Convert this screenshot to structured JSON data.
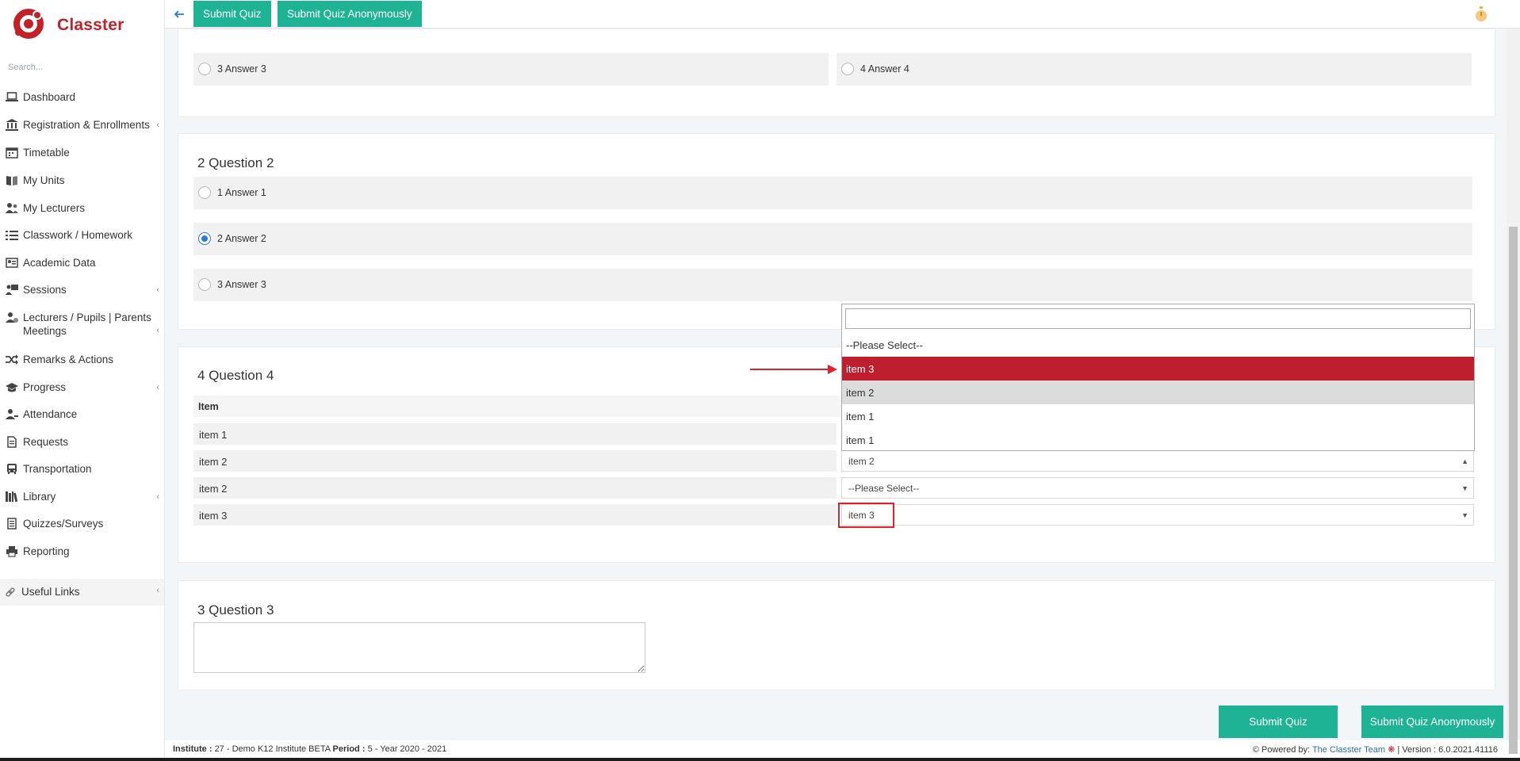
{
  "app": {
    "name": "Classter",
    "brand_color": "#c22129",
    "accent": "#1db394"
  },
  "sidebar": {
    "search_placeholder": "Search...",
    "items": [
      {
        "label": "Dashboard",
        "icon": "laptop-icon",
        "has_submenu": false
      },
      {
        "label": "Registration & Enrollments",
        "icon": "institution-icon",
        "has_submenu": true
      },
      {
        "label": "Timetable",
        "icon": "calendar-icon",
        "has_submenu": false
      },
      {
        "label": "My Units",
        "icon": "book-icon",
        "has_submenu": false
      },
      {
        "label": "My Lecturers",
        "icon": "users-icon",
        "has_submenu": false
      },
      {
        "label": "Classwork / Homework",
        "icon": "tasks-icon",
        "has_submenu": false
      },
      {
        "label": "Academic Data",
        "icon": "id-card-icon",
        "has_submenu": false
      },
      {
        "label": "Sessions",
        "icon": "presentation-icon",
        "has_submenu": true
      },
      {
        "label": "Lecturers / Pupils | Parents Meetings",
        "icon": "user-meeting-icon",
        "has_submenu": true
      },
      {
        "label": "Remarks & Actions",
        "icon": "shuffle-icon",
        "has_submenu": false
      },
      {
        "label": "Progress",
        "icon": "graduation-cap-icon",
        "has_submenu": true
      },
      {
        "label": "Attendance",
        "icon": "user-check-icon",
        "has_submenu": false
      },
      {
        "label": "Requests",
        "icon": "file-icon",
        "has_submenu": false
      },
      {
        "label": "Transportation",
        "icon": "bus-icon",
        "has_submenu": false
      },
      {
        "label": "Library",
        "icon": "library-icon",
        "has_submenu": true
      },
      {
        "label": "Quizzes/Surveys",
        "icon": "list-icon",
        "has_submenu": false
      },
      {
        "label": "Reporting",
        "icon": "printer-icon",
        "has_submenu": false
      }
    ],
    "useful_links": "Useful Links"
  },
  "toolbar": {
    "submit_quiz": "Submit Quiz",
    "submit_anon": "Submit Quiz Anonymously"
  },
  "question1_partial": {
    "answers": [
      {
        "label": "3 Answer 3",
        "checked": false
      },
      {
        "label": "4 Answer 4",
        "checked": false
      }
    ]
  },
  "question2": {
    "title": "2 Question 2",
    "answers": [
      {
        "label": "1 Answer 1",
        "checked": false
      },
      {
        "label": "2 Answer 2",
        "checked": true
      },
      {
        "label": "3 Answer 3",
        "checked": false
      }
    ]
  },
  "question4": {
    "title": "4 Question 4",
    "column_header": "Item",
    "rows": [
      {
        "item": "item 1",
        "selected": ""
      },
      {
        "item": "item 2",
        "selected": "item 2"
      },
      {
        "item": "item 2",
        "selected": "--Please Select--"
      },
      {
        "item": "item 3",
        "selected": "item 3"
      }
    ]
  },
  "dropdown": {
    "search_value": "",
    "options": [
      "--Please Select--",
      "item 3",
      "item 2",
      "item 1",
      "item 1"
    ],
    "active_index": 1,
    "hover_index": 2
  },
  "question3": {
    "title": "3 Question 3",
    "answer": ""
  },
  "footer": {
    "institute_label": "Institute :",
    "institute_value": "27 - Demo K12 Institute BETA",
    "period_label": "Period :",
    "period_value": "5 - Year 2020 - 2021",
    "powered_by": "Powered by:",
    "team_link": "The Classter Team",
    "version": "| Version : 6.0.2021.41116"
  }
}
